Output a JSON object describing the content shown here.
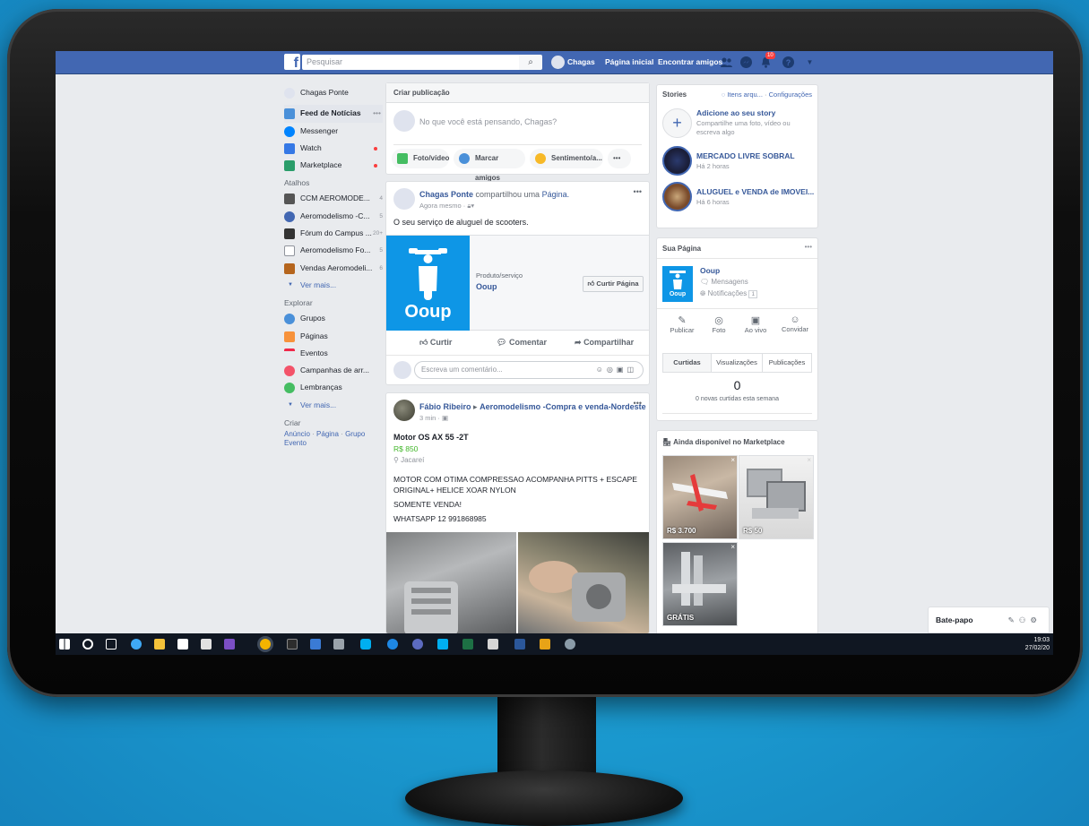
{
  "topbar": {
    "search_placeholder": "Pesquisar",
    "user_name": "Chagas",
    "home_link": "Página inicial",
    "find_friends_link": "Encontrar amigos",
    "notification_count": "10"
  },
  "leftnav": {
    "profile": "Chagas Ponte",
    "main_items": [
      {
        "label": "Feed de Notícias"
      },
      {
        "label": "Messenger"
      },
      {
        "label": "Watch"
      },
      {
        "label": "Marketplace"
      }
    ],
    "shortcuts_title": "Atalhos",
    "shortcuts": [
      {
        "label": "CCM AEROMODE...",
        "count": "4"
      },
      {
        "label": "Aeromodelismo -C...",
        "count": "5"
      },
      {
        "label": "Fórum do Campus ...",
        "count": "20+"
      },
      {
        "label": "Aeromodelismo Fo...",
        "count": "5"
      },
      {
        "label": "Vendas Aeromodeli...",
        "count": "6"
      }
    ],
    "see_more": "Ver mais...",
    "explore_title": "Explorar",
    "explore": [
      {
        "label": "Grupos"
      },
      {
        "label": "Páginas"
      },
      {
        "label": "Eventos"
      },
      {
        "label": "Campanhas de arr..."
      },
      {
        "label": "Lembranças"
      }
    ],
    "create_title": "Criar",
    "create_links": [
      "Anúncio",
      "Página",
      "Grupo",
      "Evento"
    ]
  },
  "composer": {
    "title": "Criar publicação",
    "placeholder": "No que você está pensando, Chagas?",
    "buttons": {
      "photo": "Foto/vídeo",
      "tag": "Marcar amigos",
      "feeling": "Sentimento/a...",
      "more": "•••"
    }
  },
  "post1": {
    "author": "Chagas Ponte",
    "action": "compartilhou uma",
    "object": "Página.",
    "time": "Agora mesmo",
    "text": "O seu serviço de aluguel de scooters.",
    "page_category": "Produto/serviço",
    "page_name": "Ooup",
    "like_page": "Curtir Página",
    "logo_text": "Ooup",
    "like": "Curtir",
    "comment": "Comentar",
    "share": "Compartilhar",
    "comment_placeholder": "Escreva um comentário..."
  },
  "post2": {
    "author": "Fábio Ribeiro",
    "group": "Aeromodelismo -Compra e venda-Nordeste",
    "time": "3 min",
    "item_title": "Motor OS AX 55 -2T",
    "price": "R$ 850",
    "location": "Jacareí",
    "lines": [
      "MOTOR COM OTIMA COMPRESSAO ACOMPANHA PITTS + ESCAPE",
      "ORIGINAL+ HELICE XOAR NYLON",
      "SOMENTE VENDA!",
      "WHATSAPP 12 991868985"
    ]
  },
  "stories": {
    "title": "Stories",
    "archive": "Itens arqu...",
    "settings": "Configurações",
    "add_title": "Adicione ao seu story",
    "add_sub1": "Compartilhe uma foto, vídeo ou",
    "add_sub2": "escreva algo",
    "items": [
      {
        "name": "MERCADO LIVRE SOBRAL",
        "time": "Há 2 horas"
      },
      {
        "name": "ALUGUEL e VENDA de IMOVEI...",
        "time": "Há 6 horas"
      }
    ]
  },
  "your_page": {
    "title": "Sua Página",
    "name": "Ooup",
    "messages": "Mensagens",
    "notifications": "Notificações",
    "notif_count": "1",
    "logo_text": "Ooup",
    "actions": [
      "Publicar",
      "Foto",
      "Ao vivo",
      "Convidar"
    ],
    "tabs": [
      "Curtidas",
      "Visualizações",
      "Publicações"
    ],
    "likes_count": "0",
    "likes_sub": "0 novas curtidas esta semana"
  },
  "marketplace": {
    "title": "Ainda disponível no Marketplace",
    "items": [
      {
        "price": "R$ 3.700"
      },
      {
        "price": "R$ 50"
      },
      {
        "price": "GRÁTIS"
      }
    ]
  },
  "chat": {
    "label": "Bate-papo"
  },
  "taskbar": {
    "time": "19:03",
    "date": "27/02/20"
  }
}
